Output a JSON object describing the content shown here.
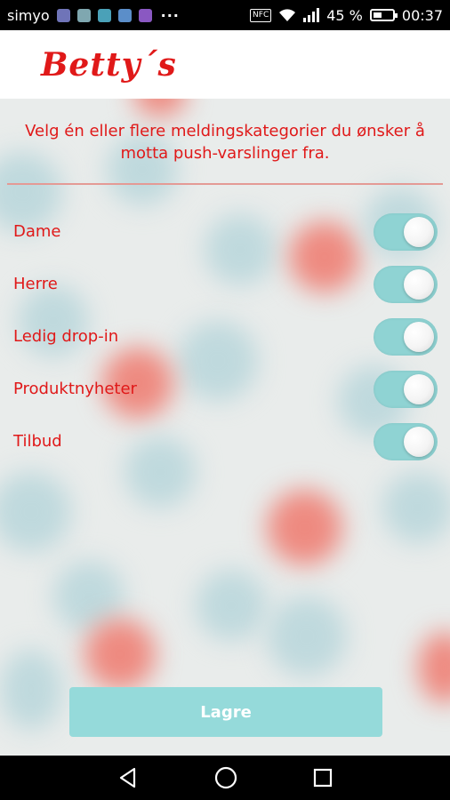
{
  "status_bar": {
    "carrier": "simyo",
    "dots": "···",
    "nfc": "NFC",
    "battery": "45 %",
    "battery_level": 0.45,
    "time": "00:37",
    "notification_icon_colors": [
      "#6f74b8",
      "#7fa7b0",
      "#4aa1b8",
      "#5b8ec9",
      "#8a58c2"
    ]
  },
  "app_bar": {
    "logo": "Betty´s"
  },
  "intro": "Velg én eller flere meldingskategorier du ønsker å motta push-varslinger fra.",
  "categories": [
    {
      "label": "Dame",
      "enabled": true
    },
    {
      "label": "Herre",
      "enabled": true
    },
    {
      "label": "Ledig drop-in",
      "enabled": true
    },
    {
      "label": "Produktnyheter",
      "enabled": true
    },
    {
      "label": "Tilbud",
      "enabled": true
    }
  ],
  "save_button": "Lagre",
  "colors": {
    "accent_red": "#e01919",
    "toggle_track": "#8fd3d3",
    "button": "#95dada"
  },
  "nav_icons": [
    "back-icon",
    "home-icon",
    "recents-icon"
  ]
}
